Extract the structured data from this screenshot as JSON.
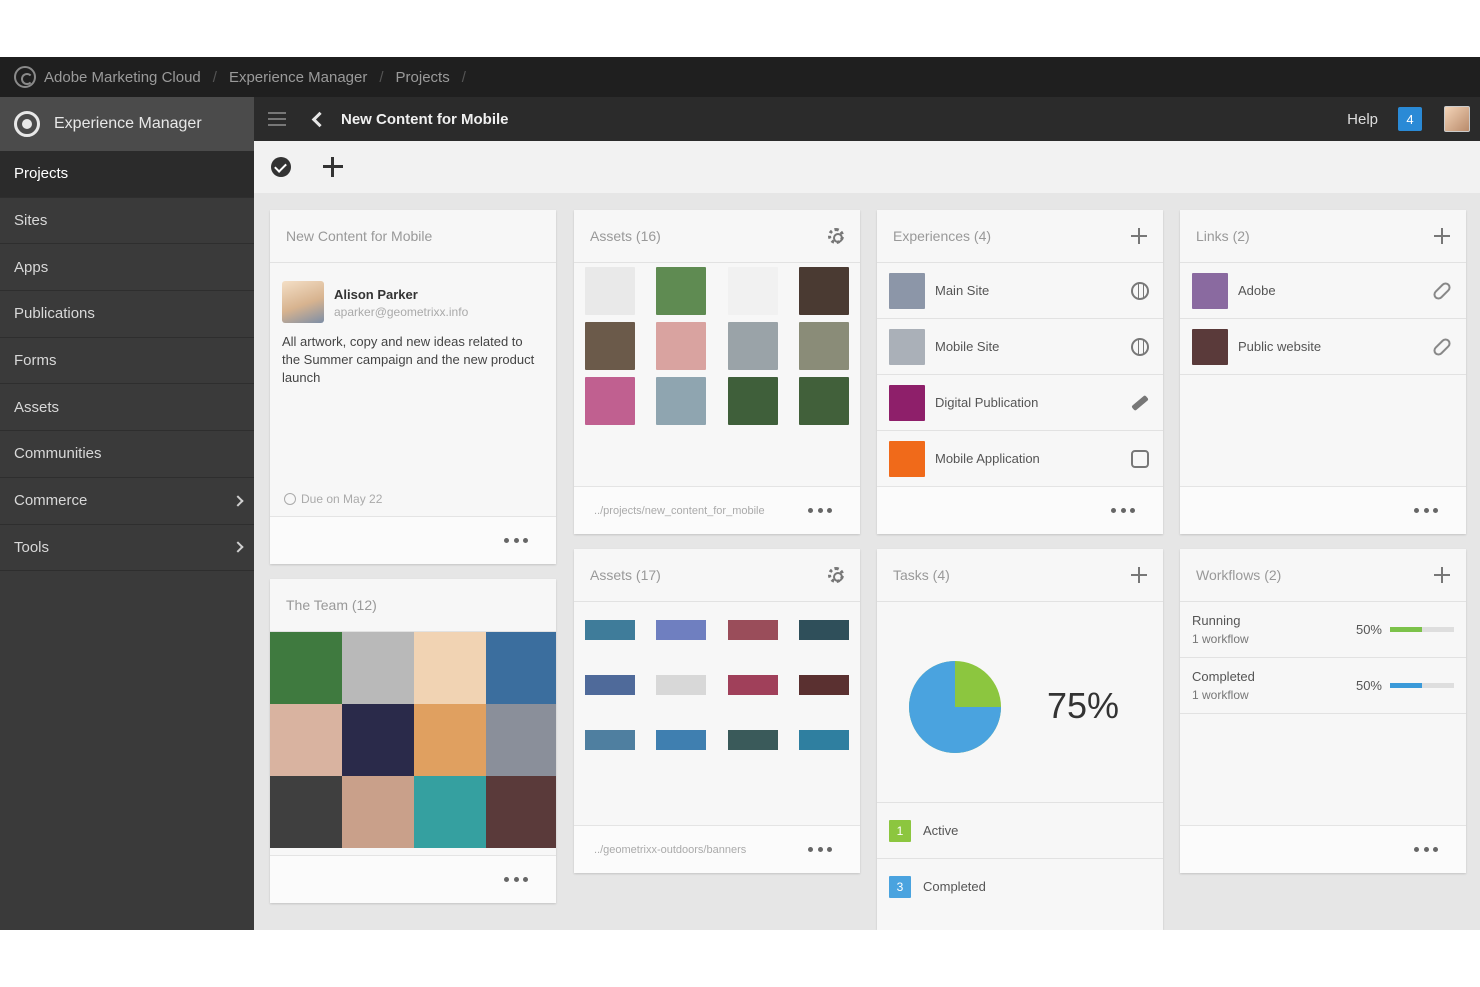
{
  "globalbar": {
    "crumbs": [
      "Adobe Marketing Cloud",
      "Experience Manager",
      "Projects"
    ]
  },
  "sidebar": {
    "brand": "Experience Manager",
    "items": [
      {
        "label": "Projects",
        "active": true,
        "has_children": false
      },
      {
        "label": "Sites",
        "active": false,
        "has_children": false
      },
      {
        "label": "Apps",
        "active": false,
        "has_children": false
      },
      {
        "label": "Publications",
        "active": false,
        "has_children": false
      },
      {
        "label": "Forms",
        "active": false,
        "has_children": false
      },
      {
        "label": "Assets",
        "active": false,
        "has_children": false
      },
      {
        "label": "Communities",
        "active": false,
        "has_children": false
      },
      {
        "label": "Commerce",
        "active": false,
        "has_children": true
      },
      {
        "label": "Tools",
        "active": false,
        "has_children": true
      }
    ]
  },
  "header": {
    "title": "New Content for Mobile",
    "help": "Help",
    "notifications": "4"
  },
  "project": {
    "title": "New Content for Mobile",
    "owner_name": "Alison Parker",
    "owner_email": "aparker@geometrixx.info",
    "description": "All artwork, copy and new ideas related to the Summer campaign and the new product launch",
    "due": "Due on May 22"
  },
  "assets1": {
    "title": "Assets (16)",
    "path": "../projects/new_content_for_mobile",
    "thumb_colors": [
      "#e9e9e9",
      "#5f8b52",
      "#f1f1f1",
      "#4a3a32",
      "#6b5a4a",
      "#d9a3a0",
      "#9aa3a8",
      "#8a8c78",
      "#c06090",
      "#8fa5b0",
      "#3f5f3a",
      "#41603a"
    ]
  },
  "assets2": {
    "title": "Assets (17)",
    "path": "../geometrixx-outdoors/banners",
    "banner_colors": [
      "#3f7c9a",
      "#6f7fc0",
      "#9a4d5a",
      "#2f4f5a",
      "#4f6a9a",
      "#d8d8d8",
      "#a0405a",
      "#5a3030",
      "#4f7fa0",
      "#3f7fb0",
      "#3a5a5a",
      "#2f7fa0"
    ]
  },
  "team": {
    "title": "The Team (12)",
    "face_colors": [
      "#3f7a3f",
      "#b9b9b9",
      "#f1d3b3",
      "#3b6e9e",
      "#d9b3a0",
      "#2a2a4a",
      "#e0a060",
      "#8a8f9a",
      "#3f3f3f",
      "#c9a08a",
      "#35a0a0",
      "#5a3a3a"
    ]
  },
  "experiences": {
    "title": "Experiences (4)",
    "items": [
      {
        "label": "Main Site",
        "icon": "globe-icon",
        "color": "#8c96a8"
      },
      {
        "label": "Mobile Site",
        "icon": "globe-icon",
        "color": "#aab0b8"
      },
      {
        "label": "Digital Publication",
        "icon": "pencil-icon",
        "color": "#8e1f6a"
      },
      {
        "label": "Mobile Application",
        "icon": "app-icon",
        "color": "#f06a1a"
      }
    ]
  },
  "links": {
    "title": "Links (2)",
    "items": [
      {
        "label": "Adobe",
        "color": "#8a6aa0"
      },
      {
        "label": "Public website",
        "color": "#5a3a3a"
      }
    ]
  },
  "tasks": {
    "title": "Tasks (4)",
    "percent_label": "75%",
    "complete_fraction": 0.75,
    "colors": {
      "complete": "#4aa3df",
      "remaining": "#8cc63f"
    },
    "rows": [
      {
        "count": "1",
        "label": "Active",
        "color": "#8cc63f"
      },
      {
        "count": "3",
        "label": "Completed",
        "color": "#4aa3df"
      }
    ]
  },
  "workflows": {
    "title": "Workflows (2)",
    "rows": [
      {
        "label": "Running",
        "sub": "1 workflow",
        "pct_label": "50%",
        "fraction": 0.5,
        "color": "#7cc24a"
      },
      {
        "label": "Completed",
        "sub": "1 workflow",
        "pct_label": "50%",
        "fraction": 0.5,
        "color": "#3a9ad9"
      }
    ]
  }
}
